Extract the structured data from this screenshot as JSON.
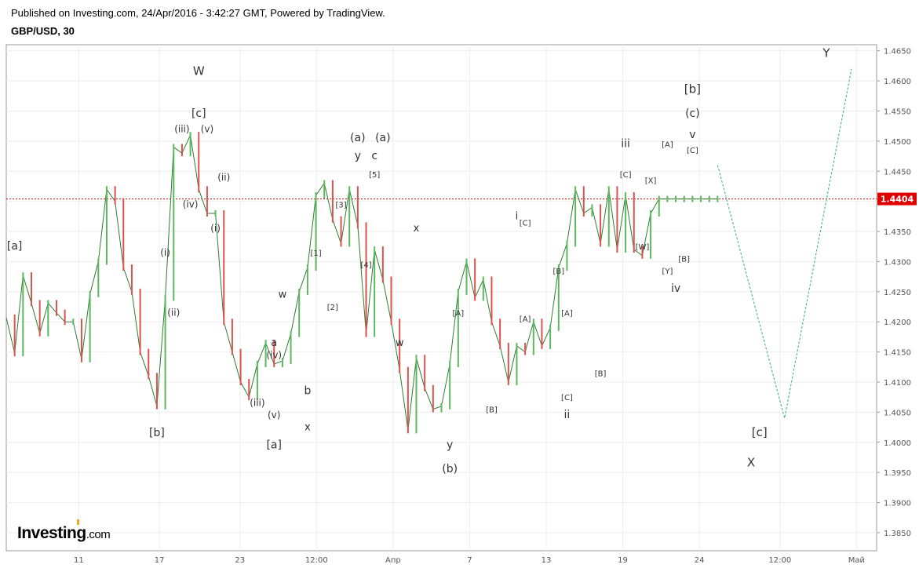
{
  "header": {
    "published": "Published on Investing.com, 24/Apr/2016 - 3:42:27 GMT, Powered by TradingView.",
    "symbol": "GBP/USD, 30"
  },
  "logo": {
    "name": "Investing",
    "domain": ".com"
  },
  "colors": {
    "bull": "#5cb85c",
    "bear": "#d9534f",
    "wedge": "#e31a1c",
    "projection": "#3aaa8d",
    "price_line": "#cc0000",
    "price_tag_bg": "#e00000",
    "grid": "#eeeeee"
  },
  "chart_data": {
    "type": "line",
    "instrument": "GBP/USD",
    "timeframe": "30",
    "ylim": [
      1.382,
      1.466
    ],
    "y_ticks": [
      "1.4650",
      "1.4600",
      "1.4550",
      "1.4500",
      "1.4450",
      "1.4400",
      "1.4350",
      "1.4300",
      "1.4250",
      "1.4200",
      "1.4150",
      "1.4100",
      "1.4050",
      "1.4000",
      "1.3950",
      "1.3900",
      "1.3850"
    ],
    "x_ticks": [
      "11",
      "17",
      "23",
      "12:00",
      "Апр",
      "7",
      "13",
      "19",
      "24",
      "12:00",
      "Май"
    ],
    "last_price_label": "1.4404",
    "last_price": 1.4404,
    "series": [
      {
        "x": [
          0,
          1,
          2,
          3,
          4,
          5,
          6,
          7,
          8,
          9,
          10,
          11,
          12,
          13,
          14,
          15,
          16,
          17,
          18,
          19,
          20,
          21,
          22,
          23,
          24,
          25,
          26,
          27,
          28,
          29,
          30,
          31,
          32,
          33,
          34,
          35,
          36,
          37,
          38,
          39,
          40,
          41,
          42,
          43,
          44,
          45,
          46,
          47,
          48,
          49,
          50,
          51,
          52,
          53,
          54,
          55,
          56,
          57,
          58,
          59,
          60,
          61,
          62,
          63,
          64,
          65,
          66,
          67,
          68,
          69,
          70,
          71,
          72,
          73,
          74,
          75,
          76,
          77,
          78,
          79,
          80,
          81,
          82,
          83,
          84,
          85
        ],
        "values": [
          1.4207,
          1.4148,
          1.4277,
          1.4231,
          1.4181,
          1.4231,
          1.4215,
          1.42,
          1.42,
          1.4138,
          1.4246,
          1.43,
          1.442,
          1.44,
          1.429,
          1.425,
          1.415,
          1.411,
          1.406,
          1.424,
          1.449,
          1.448,
          1.451,
          1.442,
          1.438,
          1.438,
          1.42,
          1.415,
          1.41,
          1.4075,
          1.413,
          1.4165,
          1.413,
          1.4135,
          1.418,
          1.425,
          1.429,
          1.441,
          1.443,
          1.437,
          1.433,
          1.442,
          1.436,
          1.418,
          1.432,
          1.427,
          1.42,
          1.412,
          1.402,
          1.414,
          1.409,
          1.4055,
          1.406,
          1.413,
          1.425,
          1.43,
          1.424,
          1.427,
          1.42,
          1.416,
          1.41,
          1.416,
          1.415,
          1.42,
          1.416,
          1.419,
          1.429,
          1.433,
          1.442,
          1.438,
          1.439,
          1.433,
          1.442,
          1.432,
          1.441,
          1.432,
          1.431,
          1.438,
          1.4404,
          1.4404,
          1.4404,
          1.4404,
          1.4404,
          1.4404,
          1.4404,
          1.4404
        ]
      }
    ],
    "projection_path": [
      {
        "x": 85,
        "y": 1.446
      },
      {
        "x": 93,
        "y": 1.404
      },
      {
        "x": 101,
        "y": 1.462
      }
    ],
    "annotations": [
      {
        "text": "W",
        "x": 23,
        "y": 1.461,
        "size": 15
      },
      {
        "text": "[c]",
        "x": 23,
        "y": 1.454,
        "size": 14
      },
      {
        "text": "(iii)",
        "x": 21,
        "y": 1.4515,
        "size": 12
      },
      {
        "text": "(v)",
        "x": 24,
        "y": 1.4515,
        "size": 12
      },
      {
        "text": "(ii)",
        "x": 26,
        "y": 1.4435,
        "size": 12
      },
      {
        "text": "(iv)",
        "x": 22,
        "y": 1.439,
        "size": 12
      },
      {
        "text": "(i)",
        "x": 25,
        "y": 1.435,
        "size": 12
      },
      {
        "text": "(i)",
        "x": 19,
        "y": 1.431,
        "size": 12
      },
      {
        "text": "(ii)",
        "x": 20,
        "y": 1.421,
        "size": 12
      },
      {
        "text": "[a]",
        "x": 1,
        "y": 1.432,
        "size": 14
      },
      {
        "text": "[b]",
        "x": 18,
        "y": 1.401,
        "size": 14
      },
      {
        "text": "w",
        "x": 33,
        "y": 1.424,
        "size": 13,
        "color": "#aaaaaa"
      },
      {
        "text": "a",
        "x": 32,
        "y": 1.416,
        "size": 13
      },
      {
        "text": "(iv)",
        "x": 32,
        "y": 1.414,
        "size": 12
      },
      {
        "text": "(iii)",
        "x": 30,
        "y": 1.406,
        "size": 12
      },
      {
        "text": "(v)",
        "x": 32,
        "y": 1.404,
        "size": 12
      },
      {
        "text": "b",
        "x": 36,
        "y": 1.408,
        "size": 14
      },
      {
        "text": "[a]",
        "x": 32,
        "y": 1.399,
        "size": 14
      },
      {
        "text": "x",
        "x": 36,
        "y": 1.402,
        "size": 13,
        "color": "#aaaaaa"
      },
      {
        "text": "[1]",
        "x": 37,
        "y": 1.431,
        "size": 10
      },
      {
        "text": "[2]",
        "x": 39,
        "y": 1.422,
        "size": 10
      },
      {
        "text": "[3]",
        "x": 40,
        "y": 1.439,
        "size": 10
      },
      {
        "text": "(a)",
        "x": 42,
        "y": 1.45,
        "size": 14,
        "color": "#aaaaaa"
      },
      {
        "text": "(a)",
        "x": 45,
        "y": 1.45,
        "size": 14
      },
      {
        "text": "y",
        "x": 42,
        "y": 1.447,
        "size": 14,
        "color": "#aaaaaa"
      },
      {
        "text": "c",
        "x": 44,
        "y": 1.447,
        "size": 14
      },
      {
        "text": "[5]",
        "x": 44,
        "y": 1.444,
        "size": 10
      },
      {
        "text": "[4]",
        "x": 43,
        "y": 1.429,
        "size": 10
      },
      {
        "text": "x",
        "x": 49,
        "y": 1.435,
        "size": 13
      },
      {
        "text": "w",
        "x": 47,
        "y": 1.416,
        "size": 13
      },
      {
        "text": "[A]",
        "x": 54,
        "y": 1.421,
        "size": 10
      },
      {
        "text": "y",
        "x": 53,
        "y": 1.399,
        "size": 14
      },
      {
        "text": "(b)",
        "x": 53,
        "y": 1.395,
        "size": 14
      },
      {
        "text": "[B]",
        "x": 58,
        "y": 1.405,
        "size": 10
      },
      {
        "text": "i",
        "x": 61,
        "y": 1.437,
        "size": 13
      },
      {
        "text": "[C]",
        "x": 62,
        "y": 1.436,
        "size": 10
      },
      {
        "text": "[B]",
        "x": 66,
        "y": 1.428,
        "size": 10
      },
      {
        "text": "[A]",
        "x": 62,
        "y": 1.42,
        "size": 10
      },
      {
        "text": "[A]",
        "x": 67,
        "y": 1.421,
        "size": 10
      },
      {
        "text": "[C]",
        "x": 67,
        "y": 1.407,
        "size": 10
      },
      {
        "text": "ii",
        "x": 67,
        "y": 1.404,
        "size": 14
      },
      {
        "text": "[B]",
        "x": 71,
        "y": 1.411,
        "size": 10
      },
      {
        "text": "iii",
        "x": 74,
        "y": 1.449,
        "size": 14
      },
      {
        "text": "[C]",
        "x": 74,
        "y": 1.444,
        "size": 10
      },
      {
        "text": "[W]",
        "x": 76,
        "y": 1.432,
        "size": 10
      },
      {
        "text": "[X]",
        "x": 77,
        "y": 1.443,
        "size": 10
      },
      {
        "text": "[A]",
        "x": 79,
        "y": 1.449,
        "size": 10
      },
      {
        "text": "[Y]",
        "x": 79,
        "y": 1.428,
        "size": 10
      },
      {
        "text": "[B]",
        "x": 81,
        "y": 1.43,
        "size": 10
      },
      {
        "text": "iv",
        "x": 80,
        "y": 1.425,
        "size": 14
      },
      {
        "text": "[b]",
        "x": 82,
        "y": 1.458,
        "size": 15
      },
      {
        "text": "(c)",
        "x": 82,
        "y": 1.454,
        "size": 14
      },
      {
        "text": "v",
        "x": 82,
        "y": 1.4505,
        "size": 14
      },
      {
        "text": "[C]",
        "x": 82,
        "y": 1.448,
        "size": 10
      },
      {
        "text": "Y",
        "x": 98,
        "y": 1.464,
        "size": 15
      },
      {
        "text": "[c]",
        "x": 90,
        "y": 1.401,
        "size": 15
      },
      {
        "text": "X",
        "x": 89,
        "y": 1.396,
        "size": 15
      }
    ]
  }
}
